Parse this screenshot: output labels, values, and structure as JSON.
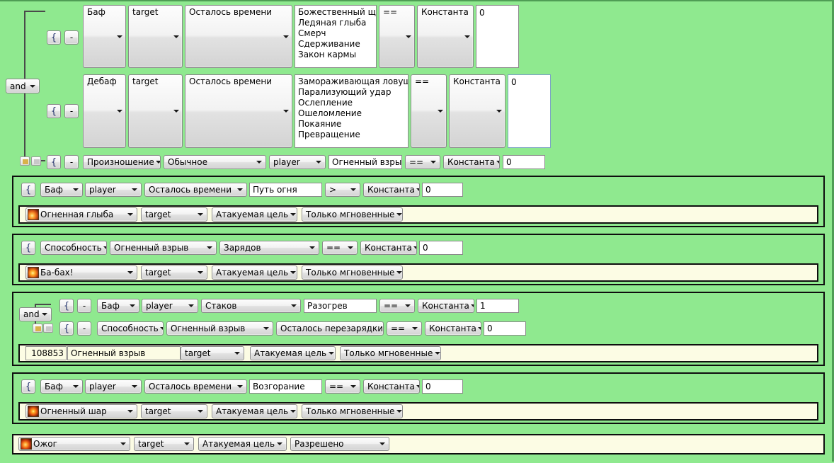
{
  "logic": {
    "and_label_1": "and",
    "and_label_2": "and",
    "brace": "{",
    "minus": "-"
  },
  "condition_group_1": {
    "rows": [
      {
        "type": "Баф",
        "unit": "target",
        "property": "Осталось времени",
        "list": [
          "Божественный щит",
          "Ледяная глыба",
          "Смерч",
          "Сдерживание",
          "Закон кармы"
        ],
        "operator": "==",
        "source": "Константа",
        "value": "0"
      },
      {
        "type": "Дебаф",
        "unit": "target",
        "property": "Осталось времени",
        "list": [
          "Замораживающая ловушка",
          "Парализующий удар",
          "Ослепление",
          "Ошеломление",
          "Покаяние",
          "Превращение"
        ],
        "operator": "==",
        "source": "Константа",
        "value": "0"
      }
    ],
    "cast_row": {
      "type": "Произношение",
      "mode": "Обычное",
      "unit": "player",
      "spell": "Огненный взрыв",
      "operator": "==",
      "source": "Константа",
      "value": "0"
    }
  },
  "blocks": [
    {
      "condition": {
        "type": "Баф",
        "unit": "player",
        "property": "Осталось времени",
        "name": "Путь огня",
        "operator": ">",
        "source": "Константа",
        "value": "0"
      },
      "action": {
        "icon": "fire-spell-icon",
        "spell": "Огненная глыба",
        "unit": "target",
        "target": "Атакуемая цель",
        "mode": "Только мгновенные"
      }
    },
    {
      "condition": {
        "type": "Способность",
        "unit": "Огненный взрыв",
        "property": "Зарядов",
        "operator": "==",
        "source": "Константа",
        "value": "0"
      },
      "action": {
        "icon": "fire-spell-icon",
        "spell": "Ба-бах!",
        "unit": "target",
        "target": "Атакуемая цель",
        "mode": "Только мгновенные"
      }
    },
    {
      "conditions": [
        {
          "type": "Баф",
          "unit": "player",
          "property": "Стаков",
          "name": "Разогрев",
          "operator": "==",
          "source": "Константа",
          "value": "1"
        },
        {
          "type": "Способность",
          "unit": "Огненный взрыв",
          "property": "Осталось перезарядки",
          "operator": "==",
          "source": "Константа",
          "value": "0"
        }
      ],
      "action": {
        "id": "108853",
        "spell": "Огненный взрыв",
        "unit": "target",
        "target": "Атакуемая цель",
        "mode": "Только мгновенные"
      }
    },
    {
      "condition": {
        "type": "Баф",
        "unit": "player",
        "property": "Осталось времени",
        "name": "Возгорание",
        "operator": "==",
        "source": "Константа",
        "value": "0"
      },
      "action": {
        "icon": "fire-spell-icon",
        "spell": "Огненный шар",
        "unit": "target",
        "target": "Атакуемая цель",
        "mode": "Только мгновенные"
      }
    }
  ],
  "final_action": {
    "icon": "fire-spell-icon",
    "spell": "Ожог",
    "unit": "target",
    "target": "Атакуемая цель",
    "mode": "Разрешено"
  },
  "colors": {
    "background": "#8fe98f",
    "action_background": "#fcfce4",
    "border": "#0e0e0e"
  }
}
